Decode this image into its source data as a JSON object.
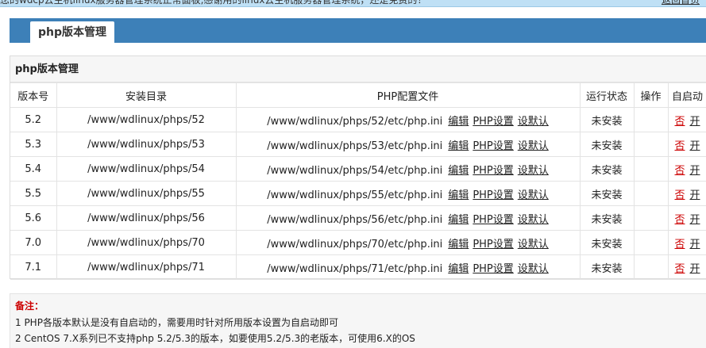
{
  "top_bar": {
    "message": "您的wdcp云主机linux服务器管理系统正常面板,感谢用的linux云主机服务器管理系统，还是免费的！",
    "link": "返回首页"
  },
  "title_tab": "php版本管理",
  "panel": {
    "heading": "php版本管理",
    "columns": [
      "版本号",
      "安装目录",
      "PHP配置文件",
      "运行状态",
      "操作",
      "自启动"
    ],
    "rows": [
      {
        "version": "5.2",
        "dir": "/www/wdlinux/phps/52",
        "ini": "/www/wdlinux/phps/52/etc/php.ini",
        "edit": "编辑",
        "settings": "PHP设置",
        "default": "设默认",
        "status": "未安装",
        "op": "",
        "auto_no": "否",
        "auto_yes": "开"
      },
      {
        "version": "5.3",
        "dir": "/www/wdlinux/phps/53",
        "ini": "/www/wdlinux/phps/53/etc/php.ini",
        "edit": "编辑",
        "settings": "PHP设置",
        "default": "设默认",
        "status": "未安装",
        "op": "",
        "auto_no": "否",
        "auto_yes": "开"
      },
      {
        "version": "5.4",
        "dir": "/www/wdlinux/phps/54",
        "ini": "/www/wdlinux/phps/54/etc/php.ini",
        "edit": "编辑",
        "settings": "PHP设置",
        "default": "设默认",
        "status": "未安装",
        "op": "",
        "auto_no": "否",
        "auto_yes": "开"
      },
      {
        "version": "5.5",
        "dir": "/www/wdlinux/phps/55",
        "ini": "/www/wdlinux/phps/55/etc/php.ini",
        "edit": "编辑",
        "settings": "PHP设置",
        "default": "设默认",
        "status": "未安装",
        "op": "",
        "auto_no": "否",
        "auto_yes": "开"
      },
      {
        "version": "5.6",
        "dir": "/www/wdlinux/phps/56",
        "ini": "/www/wdlinux/phps/56/etc/php.ini",
        "edit": "编辑",
        "settings": "PHP设置",
        "default": "设默认",
        "status": "未安装",
        "op": "",
        "auto_no": "否",
        "auto_yes": "开"
      },
      {
        "version": "7.0",
        "dir": "/www/wdlinux/phps/70",
        "ini": "/www/wdlinux/phps/70/etc/php.ini",
        "edit": "编辑",
        "settings": "PHP设置",
        "default": "设默认",
        "status": "未安装",
        "op": "",
        "auto_no": "否",
        "auto_yes": "开"
      },
      {
        "version": "7.1",
        "dir": "/www/wdlinux/phps/71",
        "ini": "/www/wdlinux/phps/71/etc/php.ini",
        "edit": "编辑",
        "settings": "PHP设置",
        "default": "设默认",
        "status": "未安装",
        "op": "",
        "auto_no": "否",
        "auto_yes": "开"
      }
    ]
  },
  "notes": {
    "title": "备注：",
    "line1": "1 PHP各版本默认是没有自启动的，需要用时针对所用版本设置为自启动即可",
    "line2": "2 CentOS 7.X系列已不支持php 5.2/5.3的版本，如要使用5.2/5.3的老版本，可使用6.X的OS"
  },
  "colors": {
    "title_bar": "#3d80b8",
    "top_bar": "#bfe0f5",
    "note_title": "#cc0000",
    "auto_no": "#cc0000"
  }
}
